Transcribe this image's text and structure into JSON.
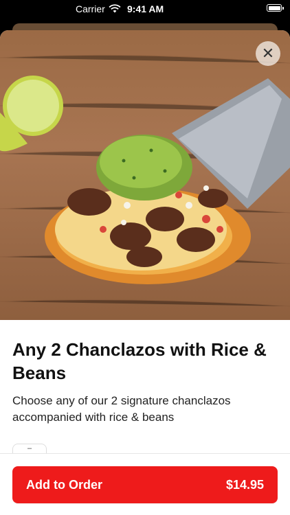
{
  "status_bar": {
    "carrier": "Carrier",
    "time": "9:41 AM"
  },
  "item": {
    "title": "Any 2 Chanclazos with Rice & Beans",
    "description": "Choose any of our 2 signature chanclazos accompanied with rice & beans",
    "image_subject": "chanclazo taco with guacamole, steak and pico de gallo on cutting board"
  },
  "controls": {
    "close_icon": "close-icon",
    "close_glyph": "✕",
    "quantity_glyph": "–"
  },
  "order": {
    "add_label": "Add to Order",
    "price": "$14.95"
  },
  "colors": {
    "accent": "#ee1b1b",
    "sheet": "#ffffff"
  }
}
